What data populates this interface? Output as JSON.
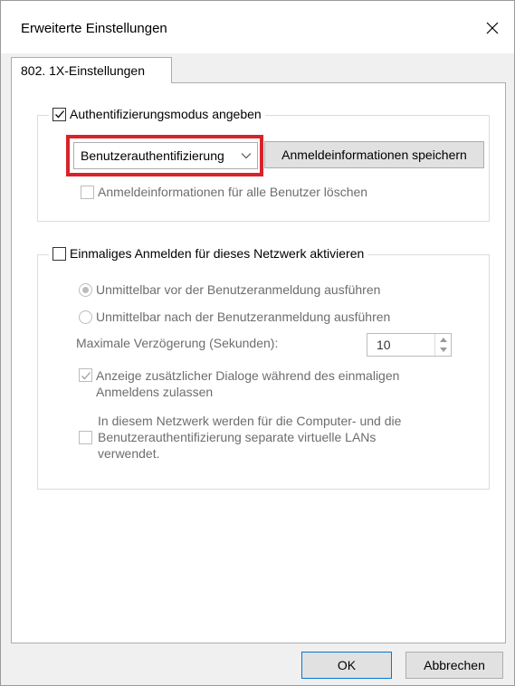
{
  "window": {
    "title": "Erweiterte Einstellungen"
  },
  "tab": {
    "label": "802. 1X-Einstellungen"
  },
  "auth_group": {
    "checkbox_label": "Authentifizierungsmodus angeben",
    "checked": true,
    "dropdown_value": "Benutzerauthentifizierung",
    "save_button": "Anmeldeinformationen speichern",
    "delete_label": "Anmeldeinformationen für alle Benutzer löschen"
  },
  "sso_group": {
    "checkbox_label": "Einmaliges Anmelden für dieses Netzwerk aktivieren",
    "checked": false,
    "radio_before": "Unmittelbar vor der Benutzeranmeldung ausführen",
    "radio_after": "Unmittelbar nach der Benutzeranmeldung ausführen",
    "delay_label": "Maximale Verzögerung (Sekunden):",
    "delay_value": "10",
    "dialogs_line1": "Anzeige zusätzlicher Dialoge während des einmaligen",
    "dialogs_line2": "Anmeldens zulassen",
    "vlan_line1": "In diesem Netzwerk werden für die Computer- und die",
    "vlan_line2": "Benutzerauthentifizierung separate virtuelle LANs",
    "vlan_line3": "verwendet."
  },
  "footer": {
    "ok": "OK",
    "cancel": "Abbrechen"
  },
  "colors": {
    "highlight": "#d8232a",
    "accent": "#0078d7"
  },
  "icons": {
    "close": "close-icon",
    "check": "checkmark-icon",
    "dropdown": "chevron-down-icon",
    "spin_up": "spin-up-icon",
    "spin_down": "spin-down-icon"
  }
}
